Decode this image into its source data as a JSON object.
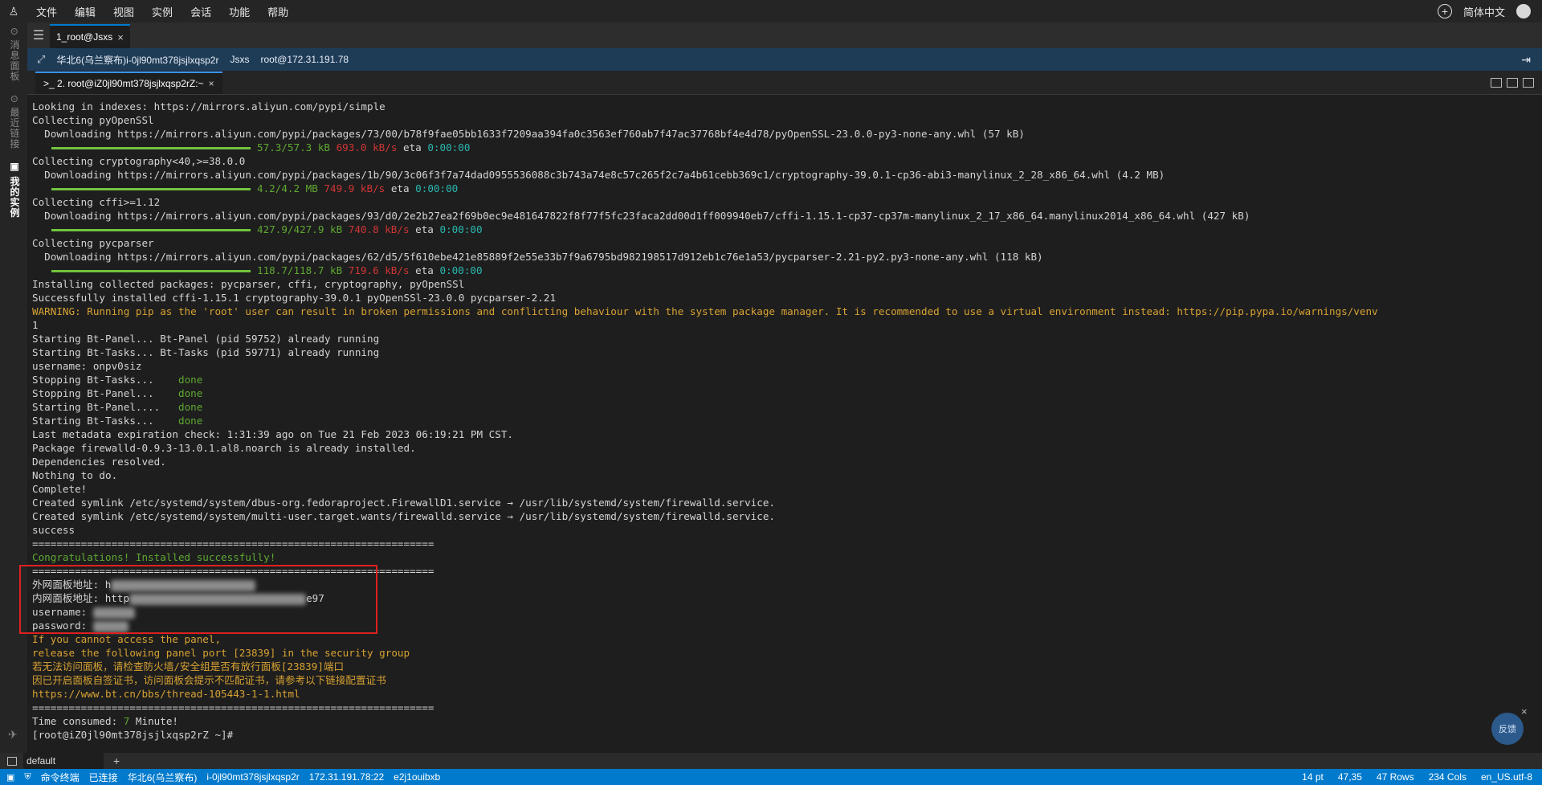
{
  "menubar": {
    "logo": "♙",
    "items": [
      "文件",
      "编辑",
      "视图",
      "实例",
      "会话",
      "功能",
      "帮助"
    ],
    "language": "简体中文"
  },
  "sidebar": {
    "tabs": [
      "⊙ 消息面板",
      "⊙ 最近链接",
      "▣ 我的实例"
    ]
  },
  "session_tab": {
    "label": "1_root@Jsxs",
    "close": "×"
  },
  "infobar": {
    "region": "华北6(乌兰察布)i-0jl90mt378jsjlxqsp2r",
    "name": "Jsxs",
    "user_ip": "root@172.31.191.78"
  },
  "terminal_tab": {
    "label": ">_ 2. root@iZ0jl90mt378jsjlxqsp2rZ:~",
    "close": "×"
  },
  "terminal": {
    "lines": [
      [
        {
          "t": "Looking in indexes: https://mirrors.aliyun.com/pypi/simple",
          "c": "white"
        }
      ],
      [
        {
          "t": "Collecting pyOpenSSl",
          "c": "white"
        }
      ],
      [
        {
          "t": "  Downloading https://mirrors.aliyun.com/pypi/packages/73/00/b78f9fae05bb1633f7209aa394fa0c3563ef760ab7f47ac37768bf4e4d78/pyOpenSSL-23.0.0-py3-none-any.whl (57 kB)",
          "c": "white"
        }
      ],
      [
        {
          "bar": true
        },
        {
          "t": "57.3/57.3 kB ",
          "c": "green"
        },
        {
          "t": "693.0 kB/s",
          "c": "red"
        },
        {
          "t": " eta ",
          "c": "white"
        },
        {
          "t": "0:00:00",
          "c": "cyan"
        }
      ],
      [
        {
          "t": "Collecting cryptography<40,>=38.0.0",
          "c": "white"
        }
      ],
      [
        {
          "t": "  Downloading https://mirrors.aliyun.com/pypi/packages/1b/90/3c06f3f7a74dad0955536088c3b743a74e8c57c265f2c7a4b61cebb369c1/cryptography-39.0.1-cp36-abi3-manylinux_2_28_x86_64.whl (4.2 MB)",
          "c": "white"
        }
      ],
      [
        {
          "bar": true
        },
        {
          "t": "4.2/4.2 MB ",
          "c": "green"
        },
        {
          "t": "749.9 kB/s",
          "c": "red"
        },
        {
          "t": " eta ",
          "c": "white"
        },
        {
          "t": "0:00:00",
          "c": "cyan"
        }
      ],
      [
        {
          "t": "Collecting cffi>=1.12",
          "c": "white"
        }
      ],
      [
        {
          "t": "  Downloading https://mirrors.aliyun.com/pypi/packages/93/d0/2e2b27ea2f69b0ec9e481647822f8f77f5fc23faca2dd00d1ff009940eb7/cffi-1.15.1-cp37-cp37m-manylinux_2_17_x86_64.manylinux2014_x86_64.whl (427 kB)",
          "c": "white"
        }
      ],
      [
        {
          "bar": true
        },
        {
          "t": "427.9/427.9 kB ",
          "c": "green"
        },
        {
          "t": "740.8 kB/s",
          "c": "red"
        },
        {
          "t": " eta ",
          "c": "white"
        },
        {
          "t": "0:00:00",
          "c": "cyan"
        }
      ],
      [
        {
          "t": "Collecting pycparser",
          "c": "white"
        }
      ],
      [
        {
          "t": "  Downloading https://mirrors.aliyun.com/pypi/packages/62/d5/5f610ebe421e85889f2e55e33b7f9a6795bd982198517d912eb1c76e1a53/pycparser-2.21-py2.py3-none-any.whl (118 kB)",
          "c": "white"
        }
      ],
      [
        {
          "bar": true
        },
        {
          "t": "118.7/118.7 kB ",
          "c": "green"
        },
        {
          "t": "719.6 kB/s",
          "c": "red"
        },
        {
          "t": " eta ",
          "c": "white"
        },
        {
          "t": "0:00:00",
          "c": "cyan"
        }
      ],
      [
        {
          "t": "Installing collected packages: pycparser, cffi, cryptography, pyOpenSSl",
          "c": "white"
        }
      ],
      [
        {
          "t": "Successfully installed cffi-1.15.1 cryptography-39.0.1 pyOpenSSl-23.0.0 pycparser-2.21",
          "c": "white"
        }
      ],
      [
        {
          "t": "WARNING: Running pip as the 'root' user can result in broken permissions and conflicting behaviour with the system package manager. It is recommended to use a virtual environment instead: https://pip.pypa.io/warnings/venv",
          "c": "yellow"
        }
      ],
      [
        {
          "t": "1",
          "c": "white"
        }
      ],
      [
        {
          "t": "Starting Bt-Panel... Bt-Panel (pid 59752) already running",
          "c": "white"
        }
      ],
      [
        {
          "t": "Starting Bt-Tasks... Bt-Tasks (pid 59771) already running",
          "c": "white"
        }
      ],
      [
        {
          "t": "username: onpv0siz",
          "c": "white"
        }
      ],
      [
        {
          "t": "Stopping Bt-Tasks...    ",
          "c": "white"
        },
        {
          "t": "done",
          "c": "green"
        }
      ],
      [
        {
          "t": "Stopping Bt-Panel...    ",
          "c": "white"
        },
        {
          "t": "done",
          "c": "green"
        }
      ],
      [
        {
          "t": "Starting Bt-Panel....   ",
          "c": "white"
        },
        {
          "t": "done",
          "c": "green"
        }
      ],
      [
        {
          "t": "Starting Bt-Tasks...    ",
          "c": "white"
        },
        {
          "t": "done",
          "c": "green"
        }
      ],
      [
        {
          "t": "Last metadata expiration check: 1:31:39 ago on Tue 21 Feb 2023 06:19:21 PM CST.",
          "c": "white"
        }
      ],
      [
        {
          "t": "Package firewalld-0.9.3-13.0.1.al8.noarch is already installed.",
          "c": "white"
        }
      ],
      [
        {
          "t": "Dependencies resolved.",
          "c": "white"
        }
      ],
      [
        {
          "t": "Nothing to do.",
          "c": "white"
        }
      ],
      [
        {
          "t": "Complete!",
          "c": "white"
        }
      ],
      [
        {
          "t": "Created symlink /etc/systemd/system/dbus-org.fedoraproject.FirewallD1.service → /usr/lib/systemd/system/firewalld.service.",
          "c": "white"
        }
      ],
      [
        {
          "t": "Created symlink /etc/systemd/system/multi-user.target.wants/firewalld.service → /usr/lib/systemd/system/firewalld.service.",
          "c": "white"
        }
      ],
      [
        {
          "t": "success",
          "c": "white"
        }
      ],
      [
        {
          "t": "==================================================================",
          "c": "white"
        }
      ],
      [
        {
          "t": "Congratulations! Installed successfully!",
          "c": "green"
        }
      ],
      [
        {
          "t": "==================================================================",
          "c": "white"
        }
      ],
      [
        {
          "t": "外网面板地址: h",
          "c": "white"
        },
        {
          "blur": true,
          "w": 180
        }
      ],
      [
        {
          "t": "内网面板地址: http",
          "c": "white"
        },
        {
          "blur": true,
          "w": 220
        },
        {
          "t": "e97",
          "c": "white"
        }
      ],
      [
        {
          "t": "username: ",
          "c": "white"
        },
        {
          "blur": true,
          "w": 52
        }
      ],
      [
        {
          "t": "password: ",
          "c": "white"
        },
        {
          "blur": true,
          "w": 44
        }
      ],
      [
        {
          "t": "If you cannot access the panel,",
          "c": "yellow"
        }
      ],
      [
        {
          "t": "release the following panel port [23839] in the security group",
          "c": "yellow"
        }
      ],
      [
        {
          "t": "若无法访问面板，请检查防火墙/安全组是否有放行面板[23839]端口",
          "c": "yellow"
        }
      ],
      [
        {
          "t": "因已开启面板自签证书，访问面板会提示不匹配证书，请参考以下链接配置证书",
          "c": "yellow"
        }
      ],
      [
        {
          "t": "https://www.bt.cn/bbs/thread-105443-1-1.html",
          "c": "yellow"
        }
      ],
      [
        {
          "t": "==================================================================",
          "c": "white"
        }
      ],
      [
        {
          "t": "Time consumed: ",
          "c": "white"
        },
        {
          "t": "7",
          "c": "green"
        },
        {
          "t": " Minute!",
          "c": "white"
        }
      ],
      [
        {
          "t": "[root@iZ0jl90mt378jsjlxqsp2rZ ~]#",
          "c": "white"
        }
      ]
    ]
  },
  "feedback": {
    "label": "反馈",
    "close": "×"
  },
  "bottom": {
    "tab": "default",
    "add": "+"
  },
  "statusbar": {
    "left": [
      "命令终端",
      "已连接",
      "华北6(乌兰察布)",
      "i-0jl90mt378jsjlxqsp2r",
      "172.31.191.78:22",
      "e2j1ouibxb"
    ],
    "right": [
      "14 pt",
      "47,35",
      "47 Rows",
      "234 Cols",
      "en_US.utf-8"
    ]
  }
}
